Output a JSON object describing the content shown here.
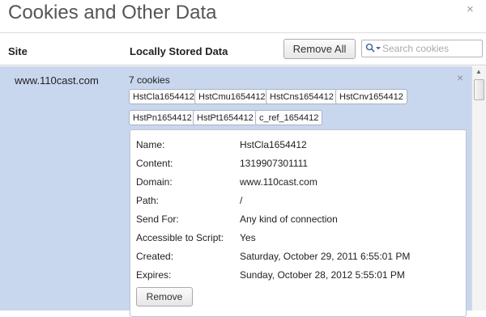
{
  "dialog": {
    "title": "Cookies and Other Data",
    "close_glyph": "×"
  },
  "header": {
    "site_label": "Site",
    "data_label": "Locally Stored Data",
    "remove_all_label": "Remove All",
    "search_placeholder": "Search cookies",
    "search_value": ""
  },
  "site": {
    "name": "www.110cast.com",
    "count_text": "7 cookies",
    "close_glyph": "×",
    "cookies": [
      "HstCla1654412",
      "HstCmu1654412",
      "HstCns1654412",
      "HstCnv1654412",
      "HstPn1654412",
      "HstPt1654412",
      "c_ref_1654412"
    ]
  },
  "details": {
    "fields": [
      {
        "label": "Name:",
        "value": "HstCla1654412"
      },
      {
        "label": "Content:",
        "value": "1319907301111"
      },
      {
        "label": "Domain:",
        "value": "www.110cast.com"
      },
      {
        "label": "Path:",
        "value": "/"
      },
      {
        "label": "Send For:",
        "value": "Any kind of connection"
      },
      {
        "label": "Accessible to Script:",
        "value": "Yes"
      },
      {
        "label": "Created:",
        "value": "Saturday, October 29, 2011 6:55:01 PM"
      },
      {
        "label": "Expires:",
        "value": "Sunday, October 28, 2012 5:55:01 PM"
      }
    ],
    "remove_label": "Remove"
  },
  "icons": {
    "dialog_close": "close-icon",
    "search": "search-icon",
    "row_close": "close-icon",
    "scroll_up": "scroll-up-arrow-icon"
  },
  "colors": {
    "selected_row": "#c8d7ee",
    "title": "#555555"
  }
}
